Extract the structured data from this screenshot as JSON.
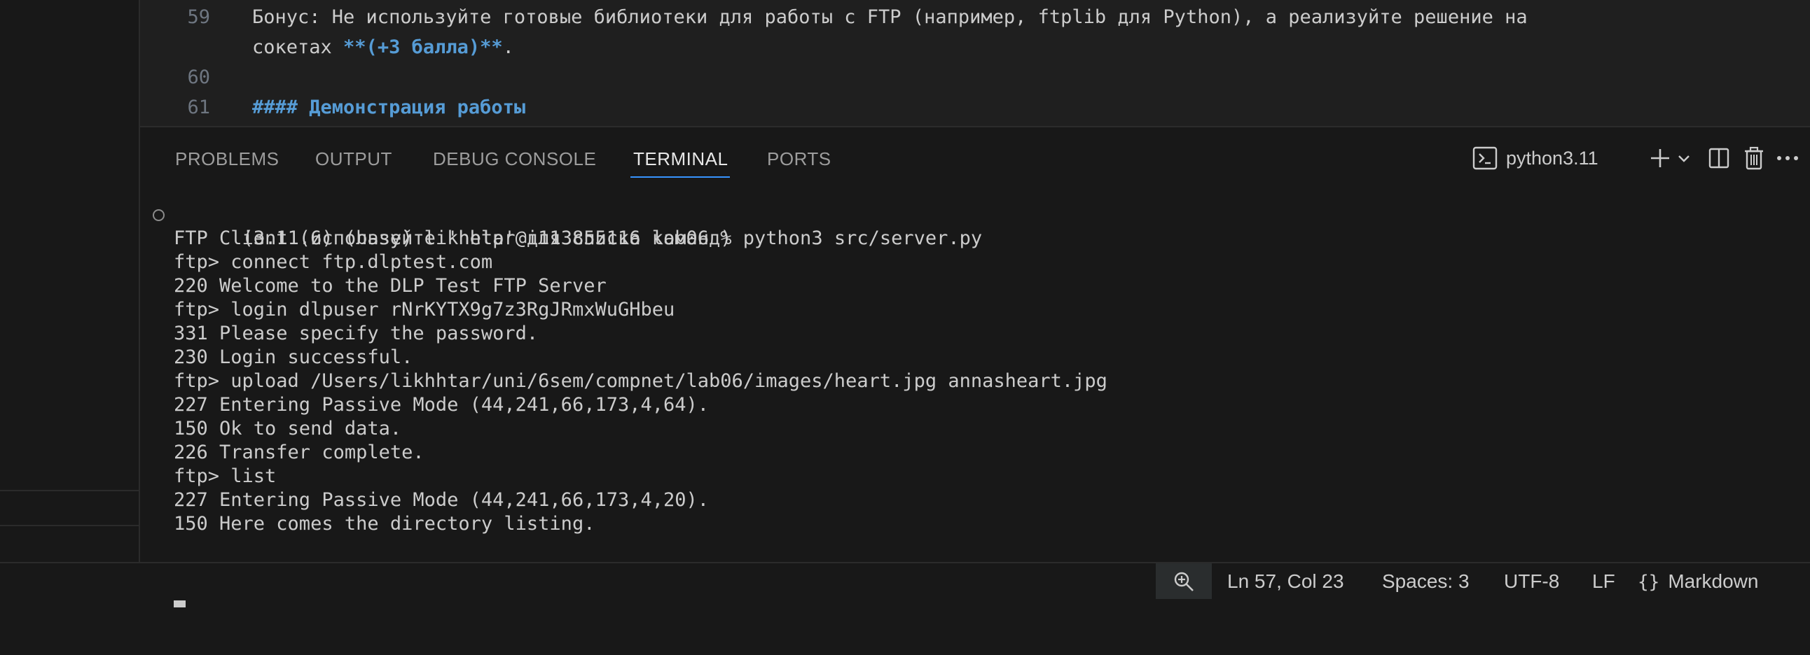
{
  "editor": {
    "lines": [
      {
        "num": "59",
        "text": "Бонус: Не используйте готовые библиотеки для работы с FTP (например, ftplib для Python), а реализуйте решение на"
      },
      {
        "num": "",
        "text": "сокетах ",
        "bold": "**(+3 балла)**",
        "tail": "."
      },
      {
        "num": "60",
        "text": ""
      },
      {
        "num": "61",
        "heading": "#### Демонстрация работы"
      }
    ]
  },
  "panel": {
    "tabs": [
      "PROBLEMS",
      "OUTPUT",
      "DEBUG CONSOLE",
      "TERMINAL",
      "PORTS"
    ],
    "active_tab": "TERMINAL",
    "terminal_name": "python3.11"
  },
  "terminal": {
    "lines": [
      "(3.11.6) (base) likhhtar@i113855116 lab06 % python3 src/server.py",
      "FTP Client (используйте 'help' для списка команд)",
      "ftp> connect ftp.dlptest.com",
      "220 Welcome to the DLP Test FTP Server",
      "ftp> login dlpuser rNrKYTX9g7z3RgJRmxWuGHbeu",
      "331 Please specify the password.",
      "230 Login successful.",
      "ftp> upload /Users/likhhtar/uni/6sem/compnet/lab06/images/heart.jpg annasheart.jpg",
      "227 Entering Passive Mode (44,241,66,173,4,64).",
      "150 Ok to send data.",
      "226 Transfer complete.",
      "ftp> list",
      "227 Entering Passive Mode (44,241,66,173,4,20).",
      "150 Here comes the directory listing."
    ]
  },
  "status": {
    "position": "Ln 57, Col 23",
    "spaces": "Spaces: 3",
    "encoding": "UTF-8",
    "eol": "LF",
    "language": "Markdown"
  }
}
